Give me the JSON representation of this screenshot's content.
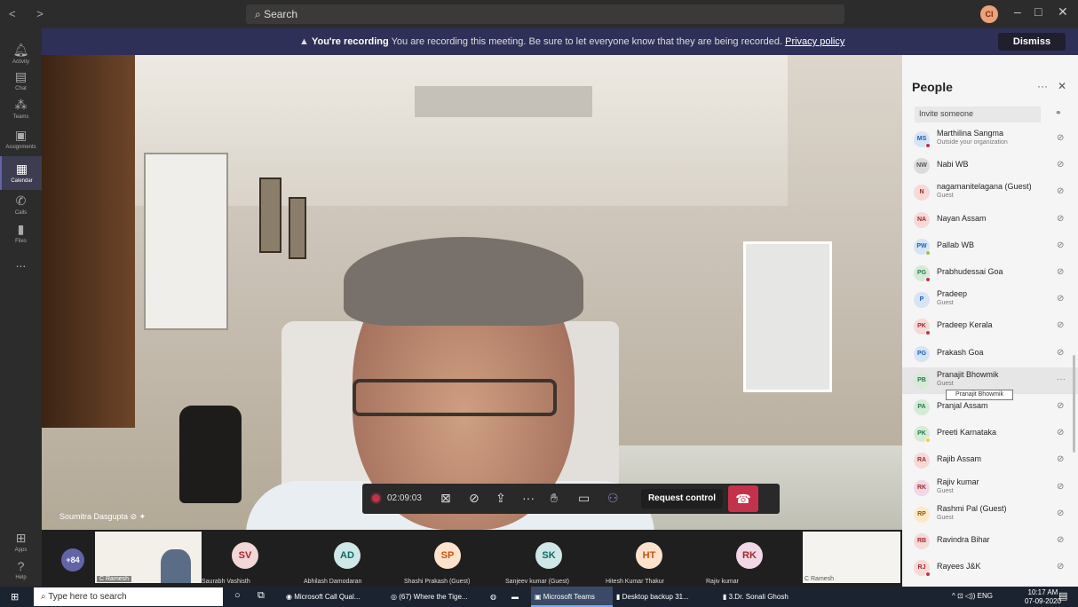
{
  "titlebar": {
    "nav": "< >",
    "search_placeholder": "Search",
    "user_initials": "CI",
    "minimize": "–",
    "maximize": "□",
    "close": "✕"
  },
  "rail": {
    "items": [
      {
        "label": "Activity",
        "icon": "bell-icon"
      },
      {
        "label": "Chat",
        "icon": "chat-icon"
      },
      {
        "label": "Teams",
        "icon": "teams-icon"
      },
      {
        "label": "Assignments",
        "icon": "assignments-icon"
      },
      {
        "label": "Calendar",
        "icon": "calendar-icon"
      },
      {
        "label": "Calls",
        "icon": "phone-icon"
      },
      {
        "label": "Files",
        "icon": "file-icon"
      },
      {
        "label": "...",
        "icon": "more-icon"
      }
    ],
    "apps": "Apps",
    "help": "Help"
  },
  "banner": {
    "bold": "You're recording",
    "text": "You are recording this meeting. Be sure to let everyone know that they are being recorded.",
    "link": "Privacy policy",
    "dismiss": "Dismiss"
  },
  "video": {
    "speaker_name": "Soumitra Dasgupta"
  },
  "controls": {
    "timer": "02:09:03",
    "request_control": "Request control"
  },
  "strip": {
    "more_count": "+84",
    "slide_label": "C Ramesh",
    "slide2_label": "C Ramesh",
    "tiles": [
      {
        "initials": "SV",
        "name": "Saurabh Vashisth",
        "bg": "#f3d6d8",
        "fg": "#a4262c"
      },
      {
        "initials": "AD",
        "name": "Abhilash Damodaran",
        "bg": "#cfe7e6",
        "fg": "#0b6a6a"
      },
      {
        "initials": "SP",
        "name": "Shashi Prakash (Guest)",
        "bg": "#fde3cc",
        "fg": "#ca5010"
      },
      {
        "initials": "SK",
        "name": "Sanjeev kumar (Guest)",
        "bg": "#cfe7e6",
        "fg": "#0b6a6a"
      },
      {
        "initials": "HT",
        "name": "Hitesh Kumar Thakur",
        "bg": "#fde3cc",
        "fg": "#ca5010"
      },
      {
        "initials": "RK",
        "name": "Rajiv kumar",
        "bg": "#f1d8e6",
        "fg": "#a4262c"
      }
    ]
  },
  "panel": {
    "title": "People",
    "more": "···",
    "close": "✕",
    "invite_placeholder": "Invite someone",
    "tooltip": "Pranajit Bhowmik",
    "people": [
      {
        "initials": "MS",
        "name": "Marthilina Sangma",
        "sub": "Outside your organization",
        "bg": "#d6e4f5",
        "fg": "#1a5fb4",
        "status": "#c4314b"
      },
      {
        "initials": "NW",
        "name": "Nabi WB",
        "sub": "",
        "bg": "#dcdcdc",
        "fg": "#555",
        "status": ""
      },
      {
        "initials": "N",
        "name": "nagamanitelagana (Guest)",
        "sub": "Guest",
        "bg": "#f5dad7",
        "fg": "#a4262c",
        "status": ""
      },
      {
        "initials": "NA",
        "name": "Nayan Assam",
        "sub": "",
        "bg": "#f5dad7",
        "fg": "#a4262c",
        "status": ""
      },
      {
        "initials": "PW",
        "name": "Pallab WB",
        "sub": "",
        "bg": "#d6e4f5",
        "fg": "#1a5fb4",
        "status": "#92c353"
      },
      {
        "initials": "PG",
        "name": "Prabhudessai Goa",
        "sub": "",
        "bg": "#d7ead7",
        "fg": "#237b4b",
        "status": "#c4314b"
      },
      {
        "initials": "P",
        "name": "Pradeep",
        "sub": "Guest",
        "bg": "#d6e4f5",
        "fg": "#1a5fb4",
        "status": ""
      },
      {
        "initials": "PK",
        "name": "Pradeep Kerala",
        "sub": "",
        "bg": "#f5dad7",
        "fg": "#a4262c",
        "status": "#c4314b"
      },
      {
        "initials": "PG",
        "name": "Prakash Goa",
        "sub": "",
        "bg": "#d6e4f5",
        "fg": "#1a5fb4",
        "status": ""
      },
      {
        "initials": "PB",
        "name": "Pranajit Bhowmik",
        "sub": "Guest",
        "bg": "#d7ead7",
        "fg": "#237b4b",
        "status": ""
      },
      {
        "initials": "PA",
        "name": "Pranjal Assam",
        "sub": "",
        "bg": "#d7ead7",
        "fg": "#237b4b",
        "status": ""
      },
      {
        "initials": "PK",
        "name": "Preeti Karnataka",
        "sub": "",
        "bg": "#d7ead7",
        "fg": "#237b4b",
        "status": "#f8d22a"
      },
      {
        "initials": "RA",
        "name": "Rajib Assam",
        "sub": "",
        "bg": "#f5dad7",
        "fg": "#a4262c",
        "status": ""
      },
      {
        "initials": "RK",
        "name": "Rajiv kumar",
        "sub": "Guest",
        "bg": "#f1d8e6",
        "fg": "#a4262c",
        "status": ""
      },
      {
        "initials": "RP",
        "name": "Rashmi Pal (Guest)",
        "sub": "Guest",
        "bg": "#fde9c7",
        "fg": "#8a5a00",
        "status": ""
      },
      {
        "initials": "RB",
        "name": "Ravindra Bihar",
        "sub": "",
        "bg": "#f5dad7",
        "fg": "#a4262c",
        "status": ""
      },
      {
        "initials": "RJ",
        "name": "Rayees J&K",
        "sub": "",
        "bg": "#f5dad7",
        "fg": "#a4262c",
        "status": "#c4314b"
      }
    ]
  },
  "taskbar": {
    "search_placeholder": "Type here to search",
    "apps": [
      {
        "label": "Microsoft Call Qual..."
      },
      {
        "label": "(67) Where the Tige..."
      },
      {
        "label": ""
      },
      {
        "label": ""
      },
      {
        "label": "Microsoft Teams"
      },
      {
        "label": "Desktop backup 31..."
      },
      {
        "label": "3.Dr. Sonali Ghosh"
      }
    ],
    "lang": "ENG",
    "time": "10:17 AM",
    "date": "07-09-2020"
  }
}
